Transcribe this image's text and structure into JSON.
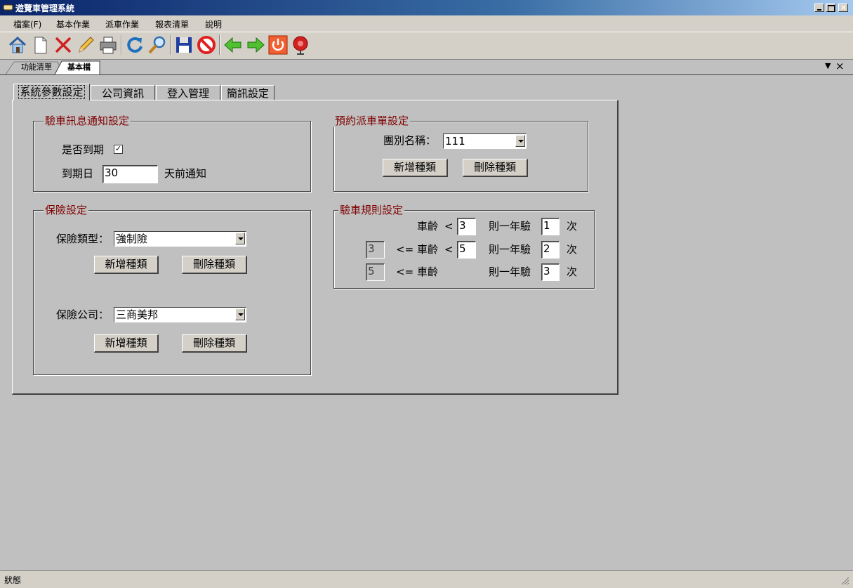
{
  "window": {
    "title": "遊覽車管理系統"
  },
  "menu": [
    "檔案(F)",
    "基本作業",
    "派車作業",
    "報表清單",
    "說明"
  ],
  "toolbar": {
    "icons": [
      "home-icon",
      "new-document-icon",
      "delete-icon",
      "edit-pencil-icon",
      "print-icon",
      "refresh-icon",
      "search-icon",
      "save-icon",
      "cancel-icon",
      "back-arrow-icon",
      "forward-arrow-icon",
      "power-icon",
      "alarm-bell-icon"
    ]
  },
  "doc_tabs": [
    "功能清單",
    "基本檔"
  ],
  "tabs": [
    "系統參數設定",
    "公司資訊",
    "登入管理",
    "簡訊設定"
  ],
  "notify": {
    "title": "驗車訊息通知設定",
    "expire_label": "是否到期",
    "expire_checked": true,
    "days_label": "到期日",
    "days_value": "30",
    "days_suffix": "天前通知"
  },
  "reserve": {
    "title": "預約派車單設定",
    "group_label": "團別名稱：",
    "group_value": "111",
    "add_label": "新增種類",
    "remove_label": "刪除種類"
  },
  "insurance": {
    "title": "保險設定",
    "type_label": "保險類型：",
    "type_value": "強制險",
    "company_label": "保險公司：",
    "company_value": "三商美邦",
    "add_label": "新增種類",
    "remove_label": "刪除種類"
  },
  "rules": {
    "title": "驗車規則設定",
    "age_label": "車齡",
    "lt": "<",
    "le": "<=",
    "per_year": "則一年驗",
    "times": "次",
    "rows": [
      {
        "from": "",
        "to": "3",
        "count": "1"
      },
      {
        "from": "3",
        "to": "5",
        "count": "2"
      },
      {
        "from": "5",
        "to": "",
        "count": "3"
      }
    ]
  },
  "status": {
    "text": "狀態"
  },
  "colors": {
    "titlebar": "#0a246a",
    "legend": "#800000",
    "background": "#c0c0c0"
  }
}
